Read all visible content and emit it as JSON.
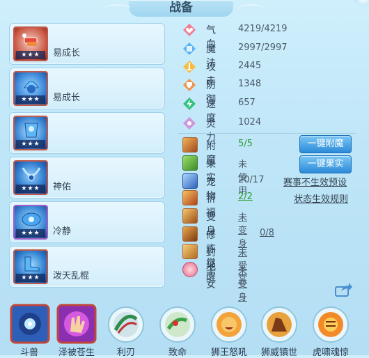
{
  "window": {
    "title": "战备"
  },
  "equipment": [
    {
      "label": "易成长",
      "stars": "★★★",
      "frame": "red"
    },
    {
      "label": "易成长",
      "stars": "★★★",
      "frame": "red"
    },
    {
      "label": "",
      "stars": "★★★",
      "frame": "red"
    },
    {
      "label": "神佑",
      "stars": "★★★",
      "frame": "red"
    },
    {
      "label": "冷静",
      "stars": "★★★",
      "frame": "purple"
    },
    {
      "label": "泼天乱棍",
      "stars": "★★★",
      "frame": "red"
    }
  ],
  "stats": [
    {
      "name": "气血",
      "value": "4219/4219",
      "icon": "heart-gem-icon",
      "color": "#e8607a"
    },
    {
      "name": "魔法",
      "value": "2997/2997",
      "icon": "diamond-gem-icon",
      "color": "#4aa6f0"
    },
    {
      "name": "攻击",
      "value": "2445",
      "icon": "sword-gem-icon",
      "color": "#f2b23a"
    },
    {
      "name": "防御",
      "value": "1348",
      "icon": "shield-gem-icon",
      "color": "#f08a3c"
    },
    {
      "name": "速度",
      "value": "657",
      "icon": "speed-gem-icon",
      "color": "#2fc07a"
    },
    {
      "name": "灵力",
      "value": "1024",
      "icon": "spirit-gem-icon",
      "color": "#c88ad8"
    }
  ],
  "attributes": [
    {
      "name": "附魔",
      "value": "5/5",
      "style": "green",
      "icon": "enchant-icon"
    },
    {
      "name": "果实",
      "value": "未使用",
      "style": "plain",
      "icon": "fruit-icon"
    },
    {
      "name": "宠物",
      "value": "20/17",
      "style": "plain",
      "icon": "pet-icon"
    },
    {
      "name": "祈福",
      "value": "2/2",
      "style": "green",
      "icon": "blessing-icon"
    },
    {
      "name": "变身",
      "value": "未变身",
      "style": "link",
      "icon": "transform-icon"
    },
    {
      "name": "修炼觉醒",
      "value": "0/8",
      "style": "link",
      "icon": "cultivation-icon"
    },
    {
      "name": "封地",
      "value": "未受赏",
      "style": "link",
      "icon": "fief-icon"
    },
    {
      "name": "子女",
      "value": "未变身",
      "style": "link",
      "icon": "child-icon"
    }
  ],
  "buttons": {
    "enchant": "一键附魔",
    "fruit": "一键果实"
  },
  "links": {
    "pet_preset": "赛事不生效预设",
    "status_rules": "状态生效规则"
  },
  "skills": [
    {
      "label": "斗兽",
      "icon": "beast-fight-icon"
    },
    {
      "label": "泽被苍生",
      "icon": "bless-hand-icon"
    },
    {
      "label": "利刃",
      "icon": "blade-icon"
    },
    {
      "label": "致命",
      "icon": "fatal-icon"
    },
    {
      "label": "狮王怒吼",
      "icon": "lion-roar-icon"
    },
    {
      "label": "狮威镇世",
      "icon": "lion-might-icon"
    },
    {
      "label": "虎啸魂惊",
      "icon": "tiger-roar-icon"
    }
  ]
}
